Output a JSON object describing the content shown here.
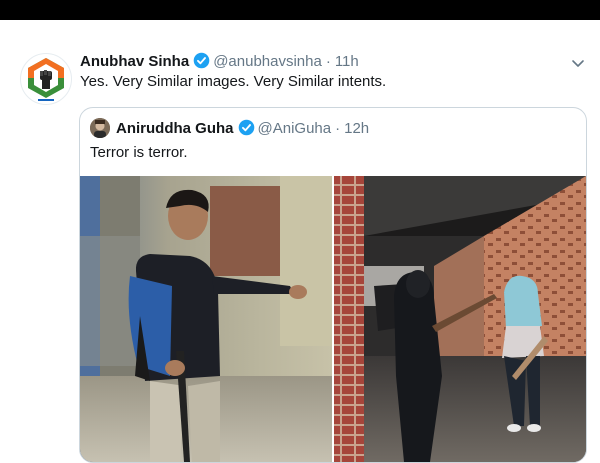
{
  "tweet": {
    "author_name": "Anubhav Sinha",
    "handle": "@anubhavsinha",
    "separator": "·",
    "time": "11h",
    "text": "Yes. Very Similar images. Very Similar intents.",
    "avatar_icon": "fist-hexagon-logo",
    "verified_icon": "verified-badge-icon",
    "menu_icon": "chevron-down-icon"
  },
  "quoted": {
    "author_name": "Aniruddha Guha",
    "handle": "@AniGuha",
    "separator": "·",
    "time": "12h",
    "text": "Terror is terror.",
    "verified_icon": "verified-badge-icon"
  },
  "colors": {
    "verified_blue": "#1da1f2",
    "text_primary": "#14171a",
    "text_secondary": "#657786",
    "border": "#ccd6dd",
    "logo_orange": "#f26f21",
    "logo_green": "#3a8f3a"
  }
}
